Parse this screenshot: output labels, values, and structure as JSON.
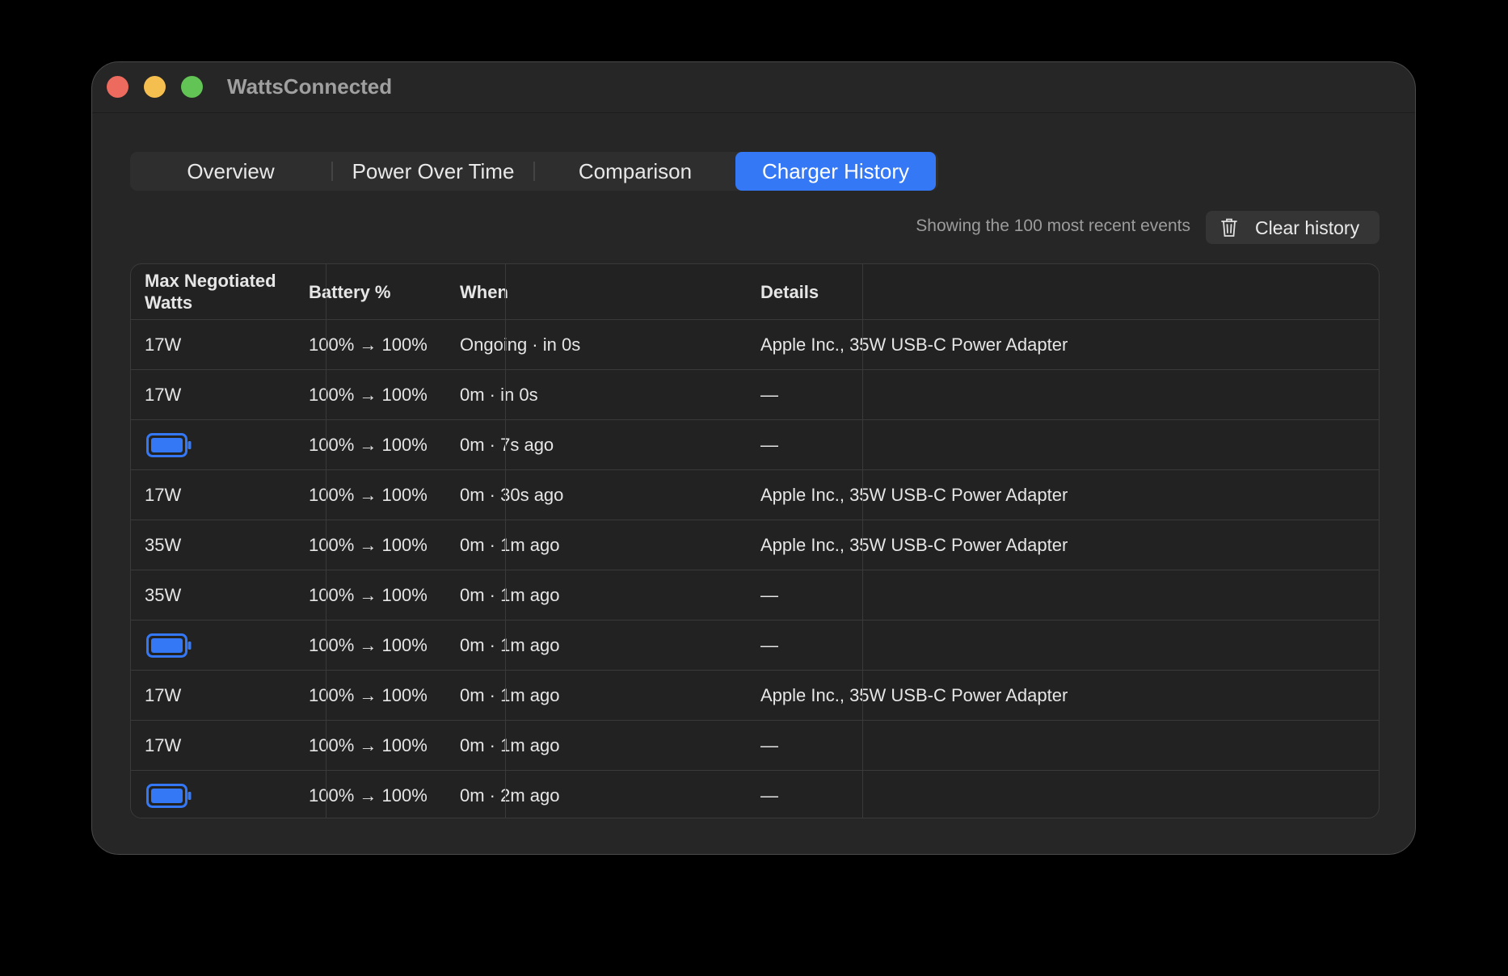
{
  "window": {
    "title": "WattsConnected"
  },
  "tabs": [
    {
      "label": "Overview",
      "active": false
    },
    {
      "label": "Power Over Time",
      "active": false
    },
    {
      "label": "Comparison",
      "active": false
    },
    {
      "label": "Charger History",
      "active": true
    }
  ],
  "toolbar": {
    "status_text": "Showing the 100 most recent events",
    "clear_label": "Clear history"
  },
  "table": {
    "headers": [
      "Max Negotiated Watts",
      "Battery %",
      "When",
      "Details"
    ],
    "rows": [
      {
        "watts": "17W",
        "battery": "100% → 100%",
        "when": "Ongoing · in 0s",
        "details": "Apple Inc., 35W USB-C Power Adapter"
      },
      {
        "watts": "17W",
        "battery": "100% → 100%",
        "when": "0m · in 0s",
        "details": "—"
      },
      {
        "watts": "",
        "icon": "battery-icon",
        "battery": "100% → 100%",
        "when": "0m · 7s ago",
        "details": "—"
      },
      {
        "watts": "17W",
        "battery": "100% → 100%",
        "when": "0m · 30s ago",
        "details": "Apple Inc., 35W USB-C Power Adapter"
      },
      {
        "watts": "35W",
        "battery": "100% → 100%",
        "when": "0m · 1m ago",
        "details": "Apple Inc., 35W USB-C Power Adapter"
      },
      {
        "watts": "35W",
        "battery": "100% → 100%",
        "when": "0m · 1m ago",
        "details": "—"
      },
      {
        "watts": "",
        "icon": "battery-icon",
        "battery": "100% → 100%",
        "when": "0m · 1m ago",
        "details": "—"
      },
      {
        "watts": "17W",
        "battery": "100% → 100%",
        "when": "0m · 1m ago",
        "details": "Apple Inc., 35W USB-C Power Adapter"
      },
      {
        "watts": "17W",
        "battery": "100% → 100%",
        "when": "0m · 1m ago",
        "details": "—"
      },
      {
        "watts": "",
        "icon": "battery-icon",
        "battery": "100% → 100%",
        "when": "0m · 2m ago",
        "details": "—"
      }
    ]
  },
  "colors": {
    "accent": "#3478f6",
    "battery_icon": "#3478f6"
  }
}
